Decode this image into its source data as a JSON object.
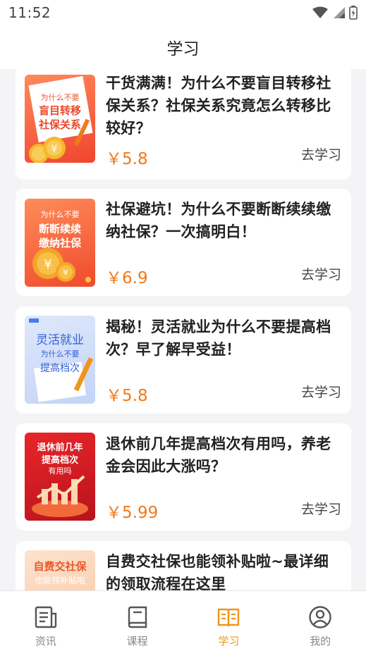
{
  "status_bar": {
    "time": "11:52",
    "icons": [
      "wifi-icon",
      "signal-icon",
      "battery-icon"
    ]
  },
  "header": {
    "title": "学习"
  },
  "colors": {
    "accent": "#f0951a",
    "price": "#f07a1a"
  },
  "courses": [
    {
      "title": "干货满满！为什么不要盲目转移社保关系？社保关系究竟怎么转移比较好？",
      "price": "￥5.8",
      "action": "去学习",
      "thumb_lines": [
        "为什么不要",
        "盲目转移",
        "社保关系"
      ]
    },
    {
      "title": "社保避坑！为什么不要断断续续缴纳社保？一次搞明白！",
      "price": "￥6.9",
      "action": "去学习",
      "thumb_lines": [
        "为什么不要",
        "断断续续",
        "缴纳社保"
      ]
    },
    {
      "title": "揭秘！灵活就业为什么不要提高档次？早了解早受益！",
      "price": "￥5.8",
      "action": "去学习",
      "thumb_lines": [
        "灵活就业",
        "为什么不要",
        "提高档次"
      ]
    },
    {
      "title": "退休前几年提高档次有用吗，养老金会因此大涨吗？",
      "price": "￥5.99",
      "action": "去学习",
      "thumb_lines": [
        "退休前几年",
        "提高档次",
        "有用吗"
      ]
    },
    {
      "title": "自费交社保也能领补贴啦~最详细的领取流程在这里",
      "thumb_lines": [
        "自费交社保",
        "也能领补贴啦"
      ]
    }
  ],
  "tabs": [
    {
      "label": "资讯",
      "icon": "news-icon",
      "active": false
    },
    {
      "label": "课程",
      "icon": "course-book-icon",
      "active": false
    },
    {
      "label": "学习",
      "icon": "open-book-icon",
      "active": true
    },
    {
      "label": "我的",
      "icon": "profile-icon",
      "active": false
    }
  ]
}
